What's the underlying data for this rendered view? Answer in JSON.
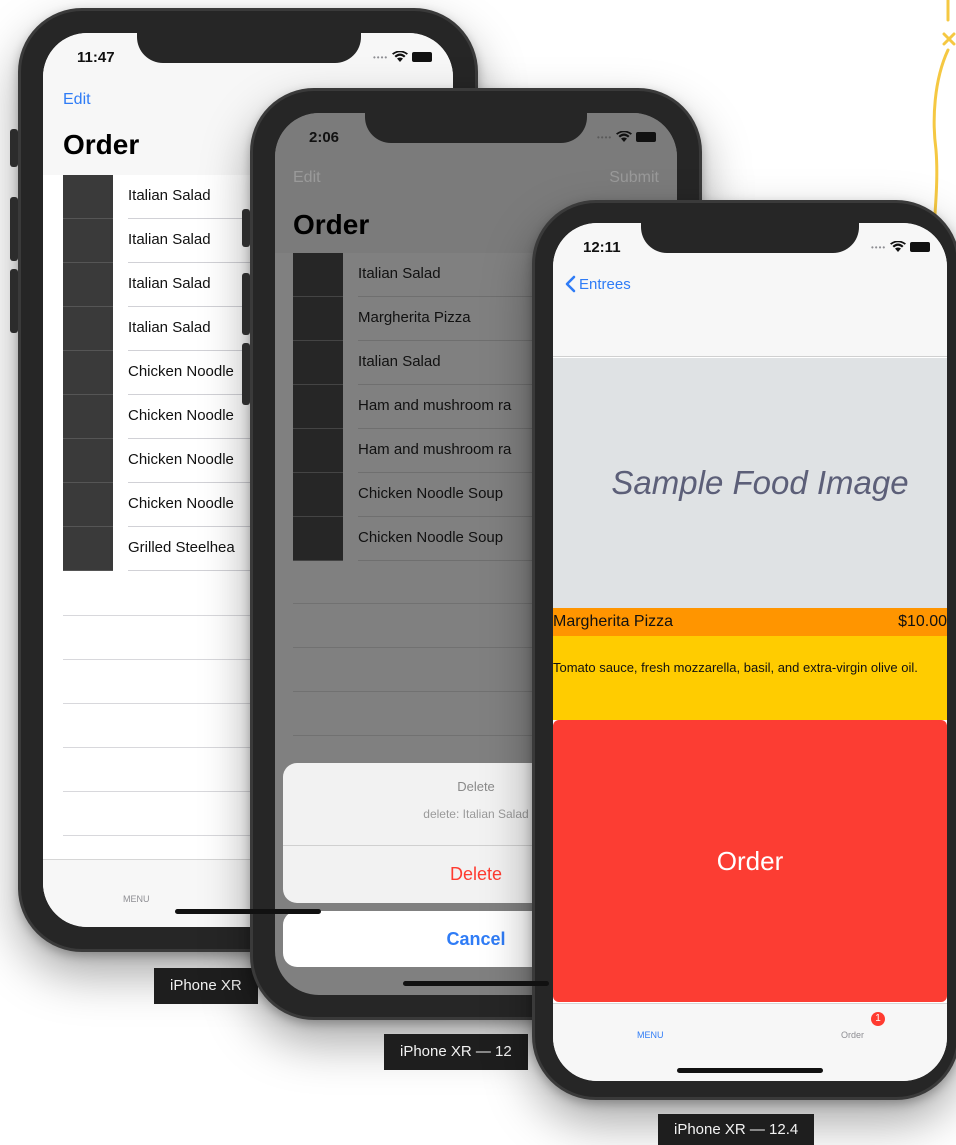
{
  "phone_order": {
    "status_time": "11:47",
    "edit_label": "Edit",
    "title": "Order",
    "rows": [
      "Italian Salad",
      "Italian Salad",
      "Italian Salad",
      "Italian Salad",
      "Chicken Noodle",
      "Chicken Noodle",
      "Chicken Noodle",
      "Chicken Noodle",
      "Grilled Steelhea"
    ],
    "tab_menu": "MENU",
    "device_label": "iPhone XR"
  },
  "phone_delete": {
    "status_time": "2:06",
    "edit_label": "Edit",
    "submit_label": "Submit",
    "title": "Order",
    "rows": [
      "Italian Salad",
      "Margherita Pizza",
      "Italian Salad",
      "Ham and mushroom ra",
      "Ham and mushroom ra",
      "Chicken Noodle Soup",
      "Chicken Noodle Soup"
    ],
    "sheet_title": "Delete",
    "sheet_message": "delete: Italian Salad",
    "delete_label": "Delete",
    "cancel_label": "Cancel",
    "device_label": "iPhone XR — 12"
  },
  "phone_detail": {
    "status_time": "12:11",
    "back_label": "Entrees",
    "image_placeholder": "Sample Food Image",
    "item_name": "Margherita Pizza",
    "item_price": "$10.00",
    "description": "Tomato sauce, fresh mozzarella, basil, and extra-virgin olive oil.",
    "order_button": "Order",
    "tab_menu": "MENU",
    "tab_order": "Order",
    "order_badge": "1",
    "device_label": "iPhone XR — 12.4"
  },
  "colors": {
    "ios_blue": "#2f7cf6",
    "destructive_red": "#ff3b30",
    "order_button_red": "#fc3d33",
    "name_bar_orange": "#ff9500",
    "description_yellow": "#ffcc00",
    "image_placeholder_bg": "#dfe2e4",
    "image_placeholder_text": "#5c5f78",
    "thumbnail": "#3a3a3a",
    "doodle_yellow": "#f5c842"
  },
  "icons": [
    "wifi-icon",
    "battery-icon",
    "chevron-left-icon",
    "home-indicator",
    "badge-icon"
  ]
}
